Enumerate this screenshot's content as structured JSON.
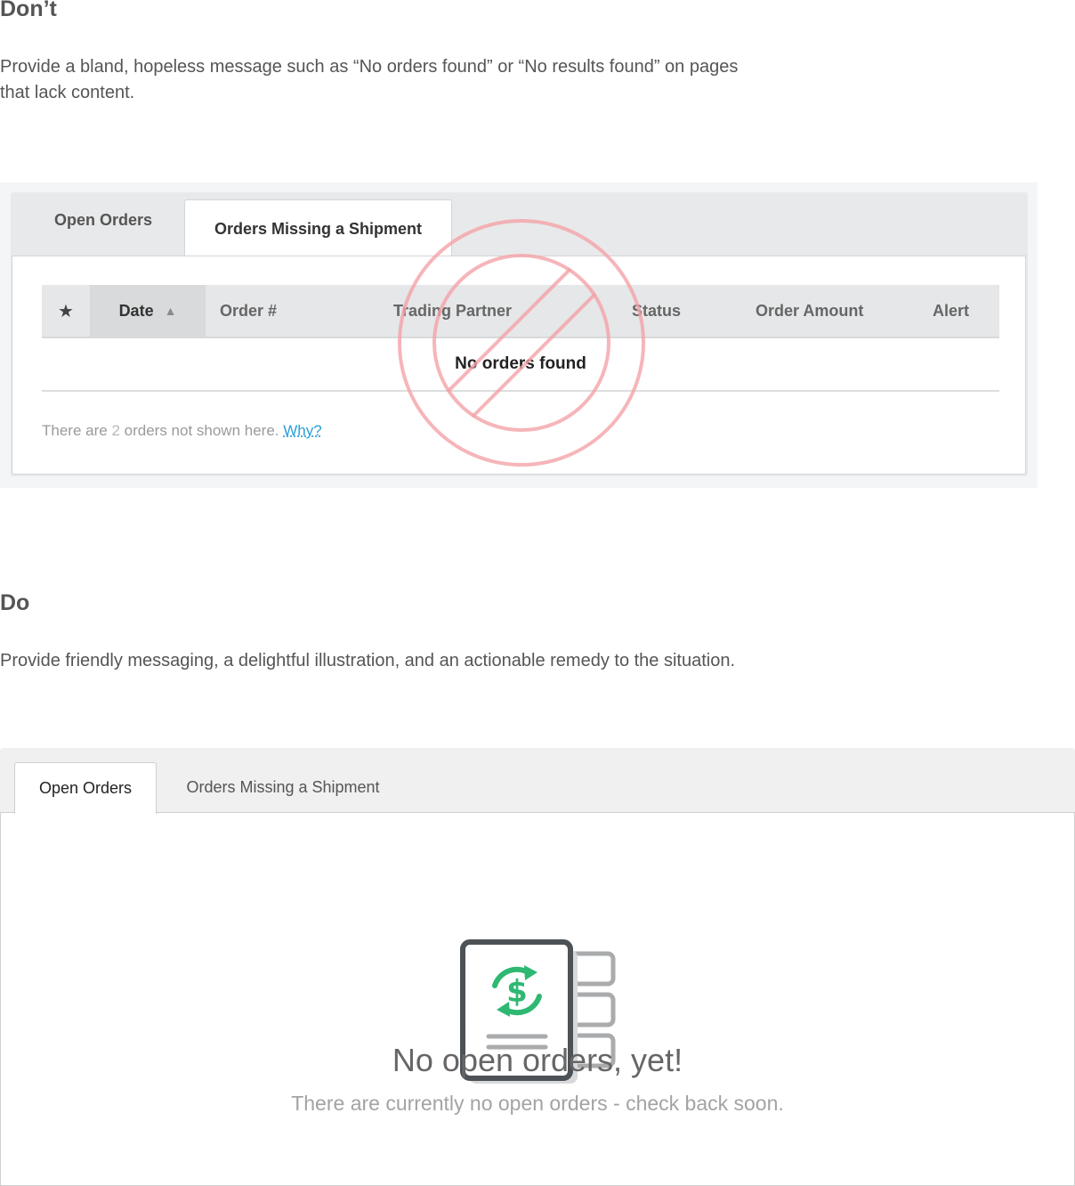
{
  "dont": {
    "heading": "Don’t",
    "description": "Provide a bland, hopeless message such as “No orders found” or “No results found” on pages that lack content.",
    "tabs": [
      "Open Orders",
      "Orders Missing a Shipment"
    ],
    "active_tab": "Orders Missing a Shipment",
    "columns": [
      "Date",
      "Order #",
      "Trading Partner",
      "Status",
      "Order Amount",
      "Alert"
    ],
    "empty_message": "No orders found",
    "footnote": {
      "prefix": "There are ",
      "count": "2",
      "suffix": " orders not shown here. ",
      "link": "Why?"
    },
    "icons": {
      "favorite": "star-icon",
      "sort": "sort-ascending-icon",
      "overlay": "prohibited-sign-icon"
    },
    "colors": {
      "link": "#2a9fd8",
      "overlay": "#f4a3a8"
    }
  },
  "do": {
    "heading": "Do",
    "description": "Provide friendly messaging, a delightful illustration, and an actionable remedy to the situation.",
    "tabs": [
      "Open Orders",
      "Orders Missing a Shipment"
    ],
    "active_tab": "Open Orders",
    "empty_title": "No open orders, yet!",
    "empty_subtitle": "There are currently no open orders - check back soon.",
    "icons": {
      "illustration": "order-document-dollar-icon"
    },
    "colors": {
      "accent": "#2eb872"
    }
  }
}
